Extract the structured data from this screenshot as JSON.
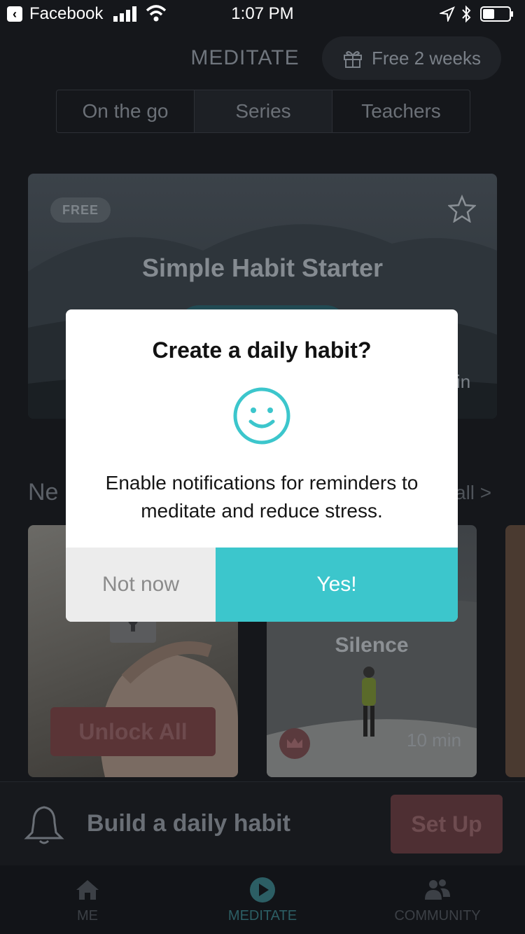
{
  "status_bar": {
    "back_app": "Facebook",
    "time": "1:07 PM"
  },
  "header": {
    "title": "MEDITATE",
    "trial_button": "Free 2 weeks"
  },
  "tabs": [
    {
      "label": "On the go"
    },
    {
      "label": "Series"
    },
    {
      "label": "Teachers"
    }
  ],
  "hero": {
    "badge": "FREE",
    "title": "Simple Habit Starter",
    "duration": "in"
  },
  "section": {
    "title_partial": "Ne",
    "see_all": "all >"
  },
  "cards": [
    {
      "button": "Unlock All"
    },
    {
      "title_line2": "Silence",
      "duration": "10 min"
    }
  ],
  "habit_bar": {
    "text": "Build a daily habit",
    "button": "Set Up"
  },
  "nav": [
    {
      "label": "ME",
      "icon": "home-icon"
    },
    {
      "label": "MEDITATE",
      "icon": "play-icon"
    },
    {
      "label": "COMMUNITY",
      "icon": "people-icon"
    }
  ],
  "dialog": {
    "title": "Create a daily habit?",
    "body": "Enable notifications for reminders to meditate and reduce stress.",
    "decline": "Not now",
    "accept": "Yes!"
  },
  "colors": {
    "accent": "#3cc6cc",
    "background": "#15171b"
  }
}
